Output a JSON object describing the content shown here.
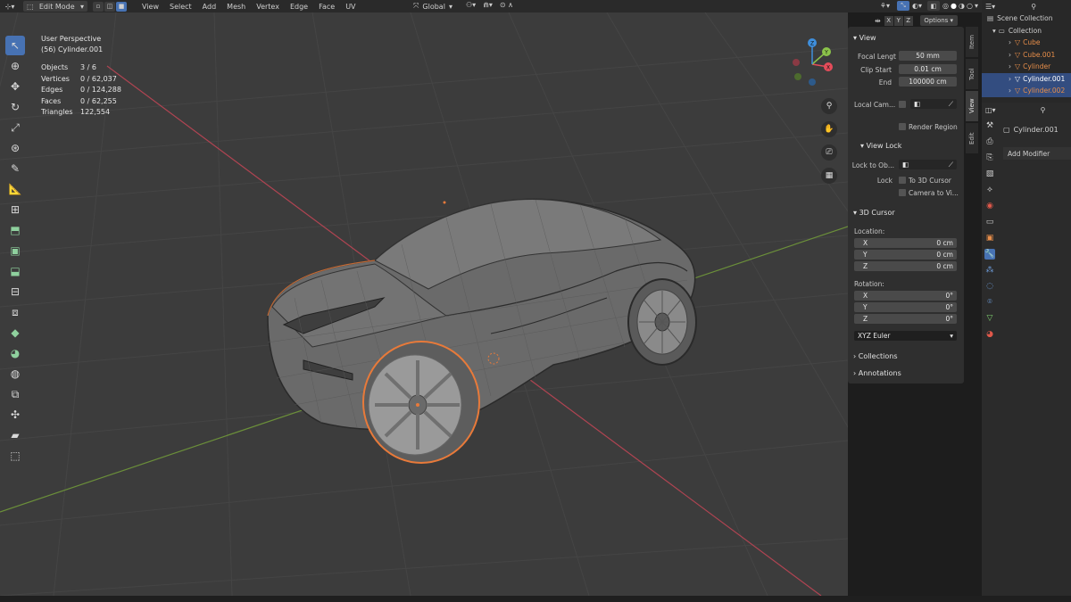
{
  "header": {
    "mode": "Edit Mode",
    "menus": [
      "View",
      "Select",
      "Add",
      "Mesh",
      "Vertex",
      "Edge",
      "Face",
      "UV"
    ],
    "transform_orientation": "Global",
    "axes": [
      "X",
      "Y",
      "Z"
    ],
    "options_label": "Options"
  },
  "viewport": {
    "view_name": "User Perspective",
    "object_name": "(56) Cylinder.001",
    "stats": [
      {
        "label": "Objects",
        "value": "3 / 6"
      },
      {
        "label": "Vertices",
        "value": "0 / 62,037"
      },
      {
        "label": "Edges",
        "value": "0 / 124,288"
      },
      {
        "label": "Faces",
        "value": "0 / 62,255"
      },
      {
        "label": "Triangles",
        "value": "122,554"
      }
    ],
    "gizmo_axes": {
      "x": "X",
      "y": "Y",
      "z": "Z"
    },
    "colors": {
      "x": "#e54c5a",
      "y": "#8bc34a",
      "z": "#3f8fdc",
      "grid": "#4a4a4a",
      "selection": "#e87a3a"
    }
  },
  "npanel": {
    "tabs": [
      "Item",
      "Tool",
      "View",
      "Edit"
    ],
    "view_section": {
      "title": "View",
      "focal_length_label": "Focal Lengt",
      "focal_length": "50 mm",
      "clip_start_label": "Clip Start",
      "clip_start": "0.01 cm",
      "end_label": "End",
      "end": "100000 cm",
      "local_camera_label": "Local Cam...",
      "render_region_label": "Render Region"
    },
    "view_lock": {
      "title": "View Lock",
      "lock_to_object_label": "Lock to Ob...",
      "lock_label": "Lock",
      "to_3d_cursor": "To 3D Cursor",
      "camera_to_view": "Camera to Vi..."
    },
    "cursor_3d": {
      "title": "3D Cursor",
      "location_label": "Location:",
      "location": [
        {
          "axis": "X",
          "value": "0 cm"
        },
        {
          "axis": "Y",
          "value": "0 cm"
        },
        {
          "axis": "Z",
          "value": "0 cm"
        }
      ],
      "rotation_label": "Rotation:",
      "rotation": [
        {
          "axis": "X",
          "value": "0°"
        },
        {
          "axis": "Y",
          "value": "0°"
        },
        {
          "axis": "Z",
          "value": "0°"
        }
      ],
      "rotation_mode": "XYZ Euler"
    },
    "collections_label": "Collections",
    "annotations_label": "Annotations"
  },
  "outliner": {
    "scene_collection": "Scene Collection",
    "collection": "Collection",
    "objects": [
      {
        "name": "Cube",
        "selected": false
      },
      {
        "name": "Cube.001",
        "selected": false
      },
      {
        "name": "Cylinder",
        "selected": false
      },
      {
        "name": "Cylinder.001",
        "selected": true
      },
      {
        "name": "Cylinder.002",
        "selected": true
      }
    ]
  },
  "properties": {
    "object_name": "Cylinder.001",
    "add_modifier_label": "Add Modifier"
  }
}
